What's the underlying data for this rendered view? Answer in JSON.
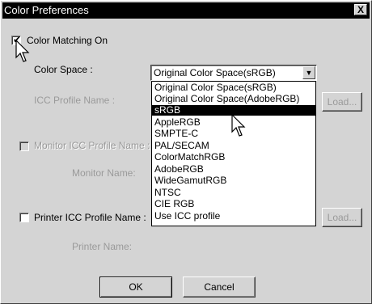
{
  "window": {
    "title": "Color Preferences",
    "close_label": "X"
  },
  "color_matching": {
    "label": "Color Matching On",
    "checked": true
  },
  "color_space": {
    "label": "Color Space :",
    "selected": "Original Color Space(sRGB)",
    "options": [
      "Original Color Space(sRGB)",
      "Original Color Space(AdobeRGB)",
      "sRGB",
      "AppleRGB",
      "SMPTE-C",
      "PAL/SECAM",
      "ColorMatchRGB",
      "AdobeRGB",
      "WideGamutRGB",
      "NTSC",
      "CIE RGB",
      "Use ICC profile"
    ],
    "highlighted": "sRGB"
  },
  "icc_profile": {
    "label": "ICC Profile Name :",
    "load_label": "Load..."
  },
  "monitor_icc": {
    "label": "Monitor ICC Profile Name :",
    "checked": false,
    "monitor_name_label": "Monitor Name:"
  },
  "printer_icc": {
    "label": "Printer ICC Profile Name :",
    "checked": false,
    "load_label": "Load...",
    "printer_name_label": "Printer Name:"
  },
  "buttons": {
    "ok": "OK",
    "cancel": "Cancel"
  },
  "icons": {
    "close": "close-icon",
    "dropdown": "chevron-down-icon",
    "cursor": "mouse-pointer-icon"
  }
}
